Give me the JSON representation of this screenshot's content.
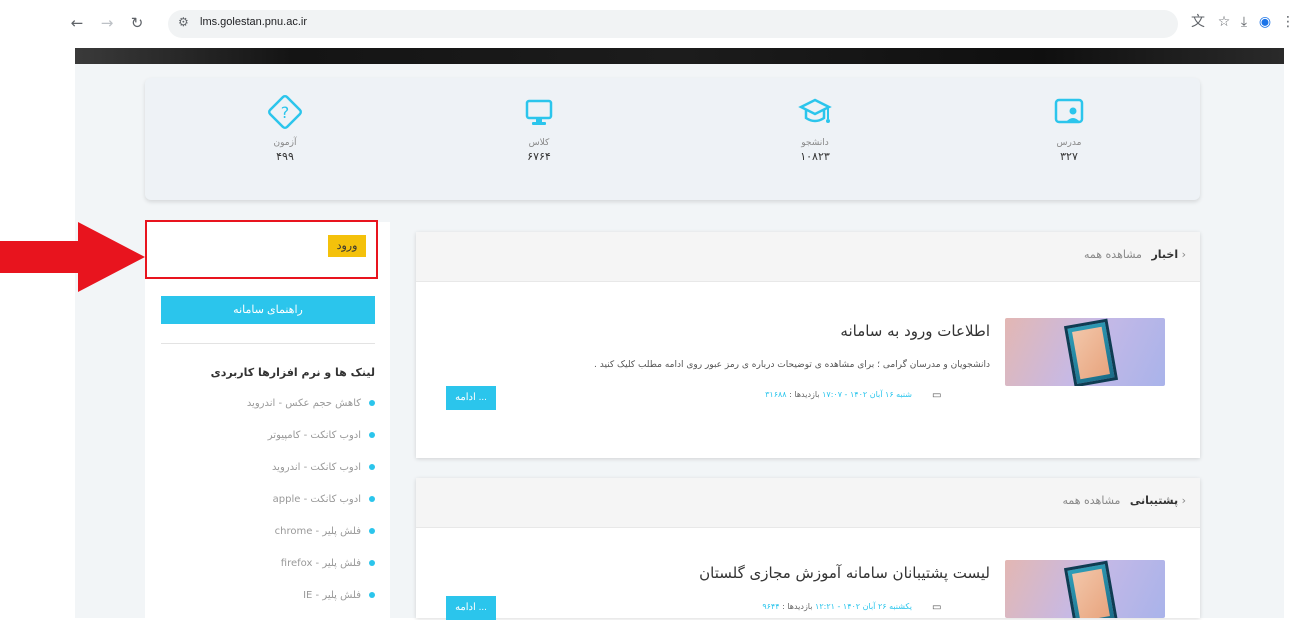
{
  "browser": {
    "url": "lms.golestan.pnu.ac.ir"
  },
  "stats": [
    {
      "icon": "help-icon",
      "label": "آزمون",
      "value": "۴۹۹"
    },
    {
      "icon": "monitor-icon",
      "label": "کلاس",
      "value": "۶۷۶۴"
    },
    {
      "icon": "graduation-cap-icon",
      "label": "دانشجو",
      "value": "۱۰۸۲۳"
    },
    {
      "icon": "teacher-icon",
      "label": "مدرس",
      "value": "۳۲۷"
    }
  ],
  "sidebar": {
    "login_label": "ورود",
    "guide_label": "راهنمای سامانه",
    "links_title": "لینک ها و نرم افزارها کاربردی",
    "links": [
      "کاهش حجم عکس - اندروید",
      "ادوب کانکت - کامپیوتر",
      "ادوب کانکت - اندروید",
      "ادوب کانکت - apple",
      "فلش پلیر - chrome",
      "فلش پلیر - firefox",
      "فلش پلیر - IE"
    ]
  },
  "news": {
    "title": "اخبار",
    "more": "مشاهده همه",
    "item_title": "اطلاعات ورود به سامانه",
    "item_desc": "دانشجویان و مدرسان گرامی ؛ برای مشاهده ی توضیحات درباره ی رمز عبور روی ادامه مطلب کلیک کنید .",
    "item_date": "شنبه ۱۶ آبان ۱۴۰۲ - ۱۷:۰۷",
    "visits_label": "بازدیدها :",
    "visits_value": "۳۱۶۸۸",
    "more_button": "ادامه ..."
  },
  "support": {
    "title": "پشتیبانی",
    "more": "مشاهده همه",
    "item_title": "لیست پشتیبانان سامانه آموزش مجازی گلستان",
    "item_date": "یکشنبه ۲۶ آبان ۱۴۰۲ - ۱۲:۲۱",
    "visits_label": "بازدیدها :",
    "visits_value": "۹۶۴۴",
    "more_button": "ادامه ..."
  }
}
